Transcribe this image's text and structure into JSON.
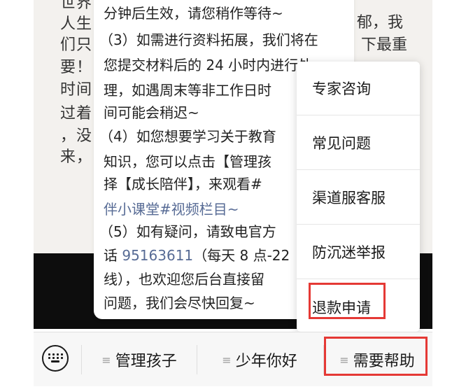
{
  "background_article": {
    "lines": [
      "世界",
      "人生",
      "们只",
      "要！",
      "时间",
      "过着",
      "，没",
      "来，"
    ],
    "right_fragments": [
      "郁，我",
      "下最重"
    ]
  },
  "message": {
    "lines": [
      "分钟后生效，请您稍作等待~",
      "（3）如需进行资料拓展，我们将在",
      "您提交材料后的 24 小时内进行处",
      "理，如遇周末等非工作日时",
      "间可能会稍迟~",
      "（4）如您想要学习关于教育",
      "知识，您可以点击【管理孩",
      "择【成长陪伴】，来观看#",
      "伴小课堂#视频栏目~",
      "（5）如有疑问，请致电官方",
      "话 ",
      "线），也欢迎您后台直接留",
      "问题，我们会尽快回复~"
    ],
    "phone": "95163611",
    "hours_text": "（每天 8 点-22",
    "link_tail": "伴小课堂#视频栏目~",
    "link_head": "#"
  },
  "popup_menu": {
    "items": [
      {
        "label": "专家咨询"
      },
      {
        "label": "常见问题"
      },
      {
        "label": "渠道服客服"
      },
      {
        "label": "防沉迷举报"
      },
      {
        "label": "退款申请"
      }
    ]
  },
  "bottom_menu": {
    "keyboard_icon": "keyboard-icon",
    "tab_icon": "≡",
    "tabs": [
      {
        "label": "管理孩子"
      },
      {
        "label": "少年你好"
      },
      {
        "label": "需要帮助"
      }
    ]
  },
  "colors": {
    "highlight": "#e53935",
    "link": "#576b95"
  }
}
